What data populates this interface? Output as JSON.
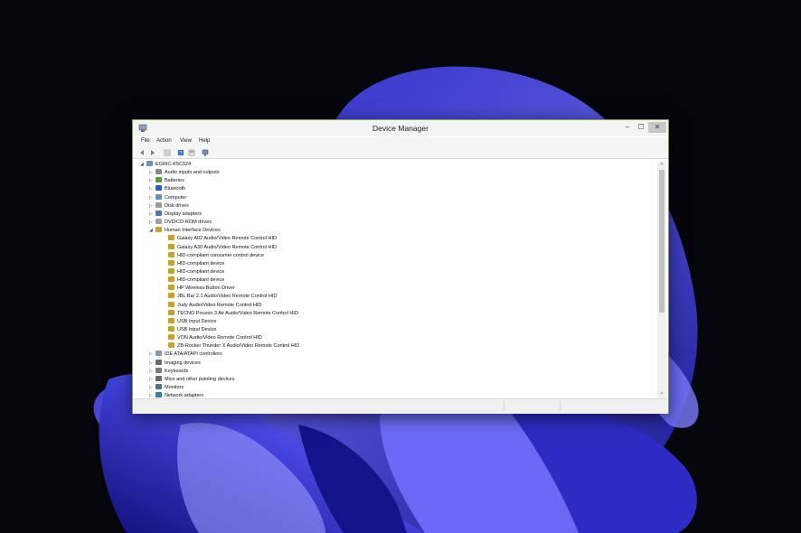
{
  "window": {
    "title": "Device Manager",
    "controls": {
      "minimize": "–",
      "maximize": "☐",
      "close": "✕"
    }
  },
  "menu": [
    "File",
    "Action",
    "View",
    "Help"
  ],
  "toolbar": [
    "back-icon",
    "forward-icon",
    "properties-icon",
    "help-icon",
    "show-hidden-icon",
    "monitor-icon"
  ],
  "tree": [
    {
      "label": "EGRIC-K5C024",
      "level": 0,
      "expander": "collapse",
      "icon": "computer-icon"
    },
    {
      "label": "Audio inputs and outputs",
      "level": 1,
      "expander": "expand",
      "icon": "audio-icon"
    },
    {
      "label": "Batteries",
      "level": 1,
      "expander": "expand",
      "icon": "battery-icon"
    },
    {
      "label": "Bluetooth",
      "level": 1,
      "expander": "expand",
      "icon": "bluetooth-icon"
    },
    {
      "label": "Computer",
      "level": 1,
      "expander": "expand",
      "icon": "computer-icon"
    },
    {
      "label": "Disk drives",
      "level": 1,
      "expander": "expand",
      "icon": "disk-icon"
    },
    {
      "label": "Display adapters",
      "level": 1,
      "expander": "expand",
      "icon": "display-icon"
    },
    {
      "label": "DVD/CD-ROM drives",
      "level": 1,
      "expander": "expand",
      "icon": "dvd-icon"
    },
    {
      "label": "Human Interface Devices",
      "level": 1,
      "expander": "collapse",
      "icon": "hid-icon"
    },
    {
      "label": "Galaxy A02 Audio/Video Remote Control HID",
      "level": 2,
      "expander": "",
      "icon": "hid-icon"
    },
    {
      "label": "Galaxy A30 Audio/Video Remote Control HID",
      "level": 2,
      "expander": "",
      "icon": "hid-icon"
    },
    {
      "label": "HID-compliant consumer control device",
      "level": 2,
      "expander": "",
      "icon": "hid-icon"
    },
    {
      "label": "HID-compliant device",
      "level": 2,
      "expander": "",
      "icon": "hid-icon"
    },
    {
      "label": "HID-compliant device",
      "level": 2,
      "expander": "",
      "icon": "hid-icon"
    },
    {
      "label": "HID-compliant device",
      "level": 2,
      "expander": "",
      "icon": "hid-icon"
    },
    {
      "label": "HP Wireless Button Driver",
      "level": 2,
      "expander": "",
      "icon": "hid-icon"
    },
    {
      "label": "JBL Bar 2.1 Audio/Video Remote Control HID",
      "level": 2,
      "expander": "",
      "icon": "hid-icon"
    },
    {
      "label": "Judy Audio/Video Remote Control HID",
      "level": 2,
      "expander": "",
      "icon": "hid-icon"
    },
    {
      "label": "TECNO Pouvoir 3 Air Audio/Video Remote Control HID",
      "level": 2,
      "expander": "",
      "icon": "hid-icon"
    },
    {
      "label": "USB Input Device",
      "level": 2,
      "expander": "",
      "icon": "hid-icon"
    },
    {
      "label": "USB Input Device",
      "level": 2,
      "expander": "",
      "icon": "hid-icon"
    },
    {
      "label": "VON Audio/Video Remote Control HID",
      "level": 2,
      "expander": "",
      "icon": "hid-icon"
    },
    {
      "label": "ZB-Rocker Thunder X Audio/Video Remote Control HID",
      "level": 2,
      "expander": "",
      "icon": "hid-icon"
    },
    {
      "label": "IDE ATA/ATAPI controllers",
      "level": 1,
      "expander": "expand",
      "icon": "ide-icon"
    },
    {
      "label": "Imaging devices",
      "level": 1,
      "expander": "expand",
      "icon": "camera-icon"
    },
    {
      "label": "Keyboards",
      "level": 1,
      "expander": "expand",
      "icon": "keyboard-icon"
    },
    {
      "label": "Mice and other pointing devices",
      "level": 1,
      "expander": "expand",
      "icon": "mouse-icon"
    },
    {
      "label": "Monitors",
      "level": 1,
      "expander": "expand",
      "icon": "monitor-icon"
    },
    {
      "label": "Network adapters",
      "level": 1,
      "expander": "expand",
      "icon": "network-icon"
    }
  ],
  "scrollbar": {
    "up": "˄",
    "down": "˅"
  },
  "colors": {
    "window_border": "#7aa35a",
    "hid_icon": "#c9a227",
    "wallpaper_blue": "#3b3bd6"
  }
}
